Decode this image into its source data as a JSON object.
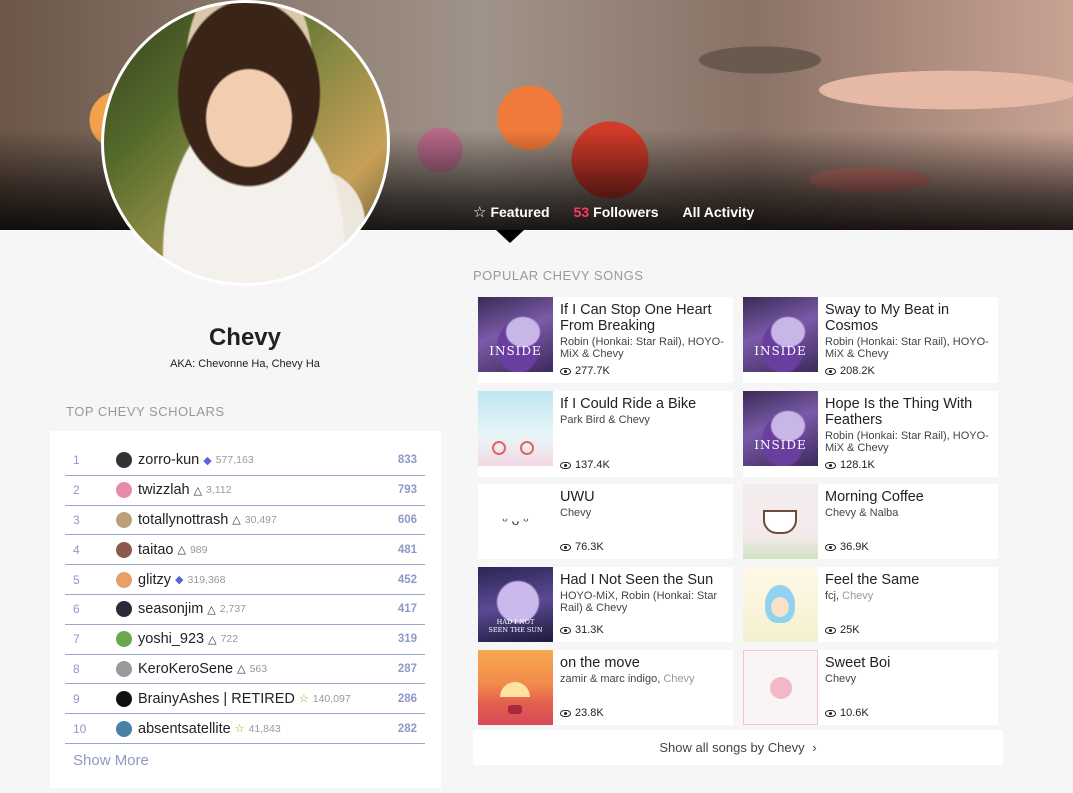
{
  "banner": {
    "tabs": [
      {
        "icon": "star-outline-icon",
        "label": "Featured"
      },
      {
        "count": "53",
        "label": "Followers"
      },
      {
        "label": "All Activity"
      }
    ]
  },
  "artist": {
    "name": "Chevy",
    "aka": "AKA: Chevonne Ha, Chevy Ha"
  },
  "scholars": {
    "title": "TOP CHEVY SCHOLARS",
    "rows": [
      {
        "rank": "1",
        "name": "zorro-kun",
        "badge": "diamond",
        "iq": "577,163",
        "points": "833"
      },
      {
        "rank": "2",
        "name": "twizzlah",
        "badge": "triangle",
        "iq": "3,112",
        "points": "793"
      },
      {
        "rank": "3",
        "name": "totallynottrash",
        "badge": "triangle",
        "iq": "30,497",
        "points": "606"
      },
      {
        "rank": "4",
        "name": "taitao",
        "badge": "triangle",
        "iq": "989",
        "points": "481"
      },
      {
        "rank": "5",
        "name": "glitzy",
        "badge": "diamond",
        "iq": "319,368",
        "points": "452"
      },
      {
        "rank": "6",
        "name": "seasonjim",
        "badge": "triangle",
        "iq": "2,737",
        "points": "417"
      },
      {
        "rank": "7",
        "name": "yoshi_923",
        "badge": "triangle",
        "iq": "722",
        "points": "319"
      },
      {
        "rank": "8",
        "name": "KeroKeroSene",
        "badge": "triangle",
        "iq": "563",
        "points": "287"
      },
      {
        "rank": "9",
        "name": "BrainyAshes | RETIRED",
        "badge": "star",
        "iq": "140,097",
        "points": "286"
      },
      {
        "rank": "10",
        "name": "absentsatellite",
        "badge": "star",
        "iq": "41,843",
        "points": "282"
      }
    ],
    "show_more": "Show More"
  },
  "songs": {
    "title": "POPULAR CHEVY SONGS",
    "items": [
      {
        "title": "If I Can Stop One Heart From Breaking",
        "artists": "Robin (Honkai: Star Rail), HOYO-MiX & Chevy",
        "artists_dim": "",
        "views": "277.7K",
        "art": "inside"
      },
      {
        "title": "Sway to My Beat in Cosmos",
        "artists": "Robin (Honkai: Star Rail), HOYO-MiX & Chevy",
        "artists_dim": "",
        "views": "208.2K",
        "art": "inside"
      },
      {
        "title": "If I Could Ride a Bike",
        "artists": "Park Bird & Chevy",
        "artists_dim": "",
        "views": "137.4K",
        "art": "bike"
      },
      {
        "title": "Hope Is the Thing With Feathers",
        "artists": "Robin (Honkai: Star Rail), HOYO-MiX & Chevy",
        "artists_dim": "",
        "views": "128.1K",
        "art": "inside"
      },
      {
        "title": "UWU",
        "artists": "Chevy",
        "artists_dim": "",
        "views": "76.3K",
        "art": "uwu"
      },
      {
        "title": "Morning Coffee",
        "artists": "Chevy & Nalba",
        "artists_dim": "",
        "views": "36.9K",
        "art": "coffee"
      },
      {
        "title": "Had I Not Seen the Sun",
        "artists": "HOYO-MiX, Robin (Honkai: Star Rail) & Chevy",
        "artists_dim": "",
        "views": "31.3K",
        "art": "hsr"
      },
      {
        "title": "Feel the Same",
        "artists": "fcj, ",
        "artists_dim": "Chevy",
        "views": "25K",
        "art": "feel"
      },
      {
        "title": "on the move",
        "artists": "zamir & marc indigo, ",
        "artists_dim": "Chevy",
        "views": "23.8K",
        "art": "move"
      },
      {
        "title": "Sweet Boi",
        "artists": "Chevy",
        "artists_dim": "",
        "views": "10.6K",
        "art": "sweet"
      }
    ],
    "show_all": "Show all songs by Chevy"
  },
  "colors": {
    "accent": "#8f98c9",
    "follower_count": "#ff3a5c",
    "background": "#f6f6f6"
  }
}
